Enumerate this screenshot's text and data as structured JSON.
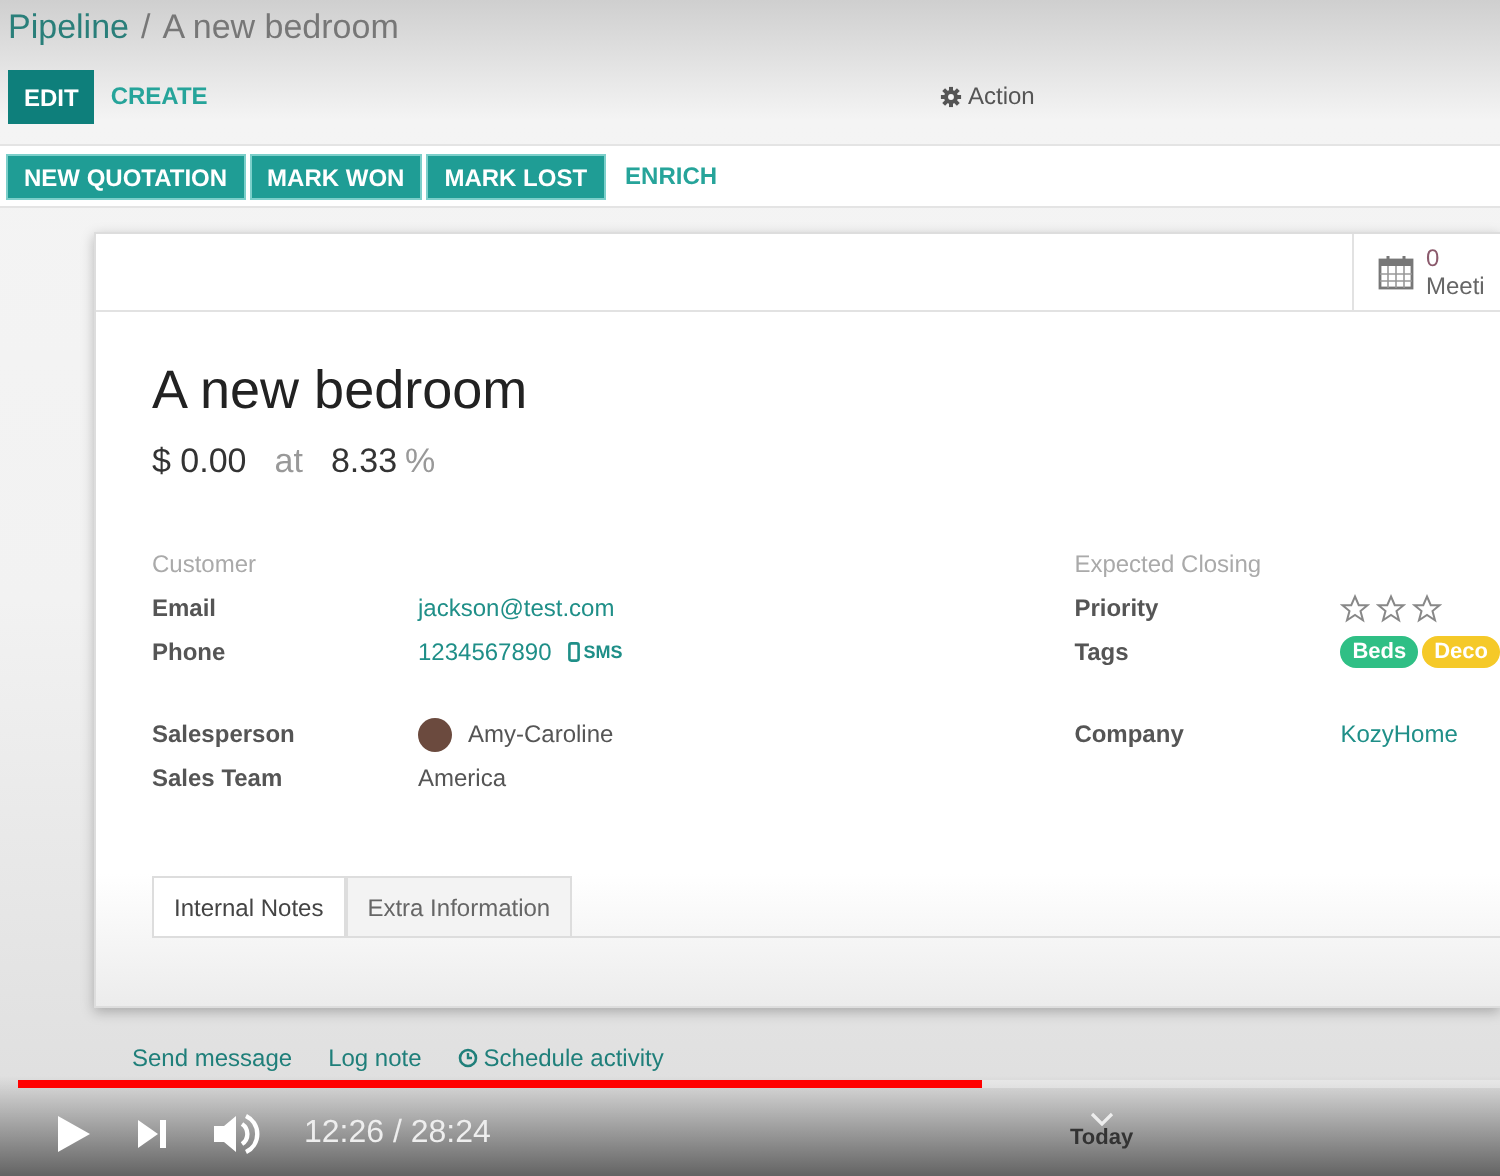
{
  "breadcrumb": {
    "parent": "Pipeline",
    "separator": "/",
    "current": "A new bedroom"
  },
  "control_buttons": [
    {
      "label": "EDIT",
      "kind": "primary"
    },
    {
      "label": "CREATE",
      "kind": "link"
    }
  ],
  "action_menu": {
    "label": "Action"
  },
  "status_buttons": [
    {
      "label": "NEW QUOTATION",
      "kind": "primary"
    },
    {
      "label": "MARK WON",
      "kind": "primary"
    },
    {
      "label": "MARK LOST",
      "kind": "primary"
    },
    {
      "label": "ENRICH",
      "kind": "link"
    }
  ],
  "smart_button": {
    "count": "0",
    "label": "Meeti"
  },
  "record": {
    "title": "A new bedroom",
    "revenue": "$ 0.00",
    "at": "at",
    "probability": "8.33",
    "percent": "%"
  },
  "left_fields": [
    {
      "kind": "heading",
      "label": "Customer"
    },
    {
      "kind": "link",
      "label": "Email",
      "value": "jackson@test.com"
    },
    {
      "kind": "phone",
      "label": "Phone",
      "value": "1234567890",
      "action": "SMS"
    },
    {
      "kind": "gap"
    },
    {
      "kind": "user",
      "label": "Salesperson",
      "value": "Amy-Caroline"
    },
    {
      "kind": "text",
      "label": "Sales Team",
      "value": "America"
    }
  ],
  "right_fields": [
    {
      "kind": "heading",
      "label": "Expected Closing"
    },
    {
      "kind": "stars",
      "label": "Priority",
      "stars": 0
    },
    {
      "kind": "tags",
      "label": "Tags",
      "tags": [
        {
          "label": "Beds",
          "color": "#2fbf85"
        },
        {
          "label": "Deco",
          "color": "#f5c928"
        }
      ]
    },
    {
      "kind": "gap"
    },
    {
      "kind": "link",
      "label": "Company",
      "value": "KozyHome"
    }
  ],
  "notebook_tabs": [
    {
      "label": "Internal Notes",
      "selected": true
    },
    {
      "label": "Extra Information",
      "selected": false
    }
  ],
  "chatter": [
    {
      "label": "Send message",
      "kind": "link"
    },
    {
      "label": "Log note",
      "kind": "link"
    },
    {
      "label": "Schedule activity",
      "kind": "activity"
    }
  ],
  "player": {
    "level": 0.65,
    "time": "12:26 / 28:24",
    "today": "Today"
  }
}
